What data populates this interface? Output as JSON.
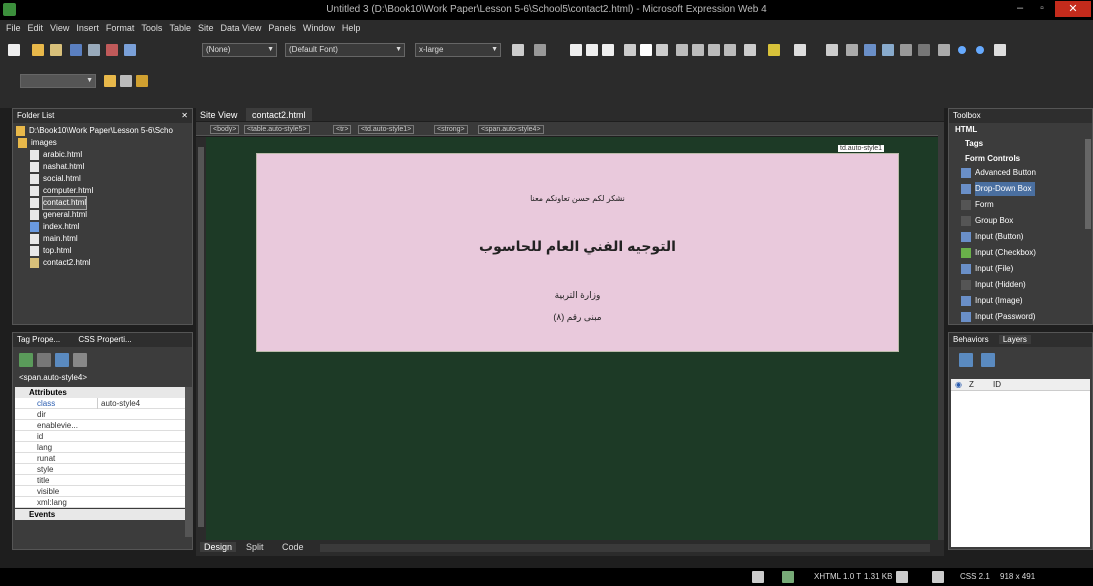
{
  "window": {
    "title": "Untitled 3 (D:\\Book10\\Work Paper\\Lesson 5-6\\School5\\contact2.html) - Microsoft Expression Web 4",
    "min": "‒",
    "max": "▫",
    "close": "✕"
  },
  "menu": [
    "File",
    "Edit",
    "View",
    "Insert",
    "Format",
    "Tools",
    "Table",
    "Site",
    "Data View",
    "Panels",
    "Window",
    "Help"
  ],
  "toolbar": {
    "style_combo": "(None)",
    "font_combo": "(Default Font)",
    "size_combo": "x-large"
  },
  "folder_list": {
    "title": "Folder List",
    "root": "D:\\Book10\\Work Paper\\Lesson 5-6\\Scho",
    "items": [
      "images",
      "arabic.html",
      "nashat.html",
      "social.html",
      "computer.html",
      "contact.html",
      "general.html",
      "index.html",
      "main.html",
      "top.html",
      "contact2.html"
    ]
  },
  "tag_props": {
    "tab1": "Tag Prope...",
    "tab2": "CSS Properti...",
    "tag": "<span.auto-style4>",
    "section": "Attributes",
    "rows": [
      {
        "name": "class",
        "value": "auto-style4"
      },
      {
        "name": "dir",
        "value": ""
      },
      {
        "name": "enablevie...",
        "value": ""
      },
      {
        "name": "id",
        "value": ""
      },
      {
        "name": "lang",
        "value": ""
      },
      {
        "name": "runat",
        "value": ""
      },
      {
        "name": "style",
        "value": ""
      },
      {
        "name": "title",
        "value": ""
      },
      {
        "name": "visible",
        "value": ""
      },
      {
        "name": "xml:lang",
        "value": ""
      }
    ],
    "events": "Events"
  },
  "editor": {
    "tab_site": "Site View",
    "tab_file": "contact2.html",
    "breadcrumb": [
      "<body>",
      "<table.auto-style5>",
      "<tr>",
      "<td.auto-style1>",
      "<strong>",
      "<span.auto-style4>"
    ],
    "cell_label": "td.auto-style1",
    "line1": "نشكر لكم حسن تعاونكم معنا",
    "line2": "التوجيه الفني العام للحاسوب",
    "line3": "وزارة التربية",
    "line4": "مبنى رقم (٨)",
    "view_tabs": [
      "Design",
      "Split",
      "Code"
    ]
  },
  "toolbox": {
    "title": "Toolbox",
    "html": "HTML",
    "tags": "Tags",
    "form_controls": "Form Controls",
    "items": [
      "Advanced Button",
      "Drop-Down Box",
      "Form",
      "Group Box",
      "Input (Button)",
      "Input (Checkbox)",
      "Input (File)",
      "Input (Hidden)",
      "Input (Image)",
      "Input (Password)"
    ]
  },
  "layers": {
    "tab1": "Behaviors",
    "tab2": "Layers",
    "col_z": "Z",
    "col_id": "ID"
  },
  "status": {
    "doctype": "XHTML 1.0 T",
    "size": "1.31 KB",
    "css": "CSS 2.1",
    "dims": "918 x 491"
  },
  "colors": {
    "page_bg": "#e9c9dc",
    "canvas": "#1d3a26"
  }
}
